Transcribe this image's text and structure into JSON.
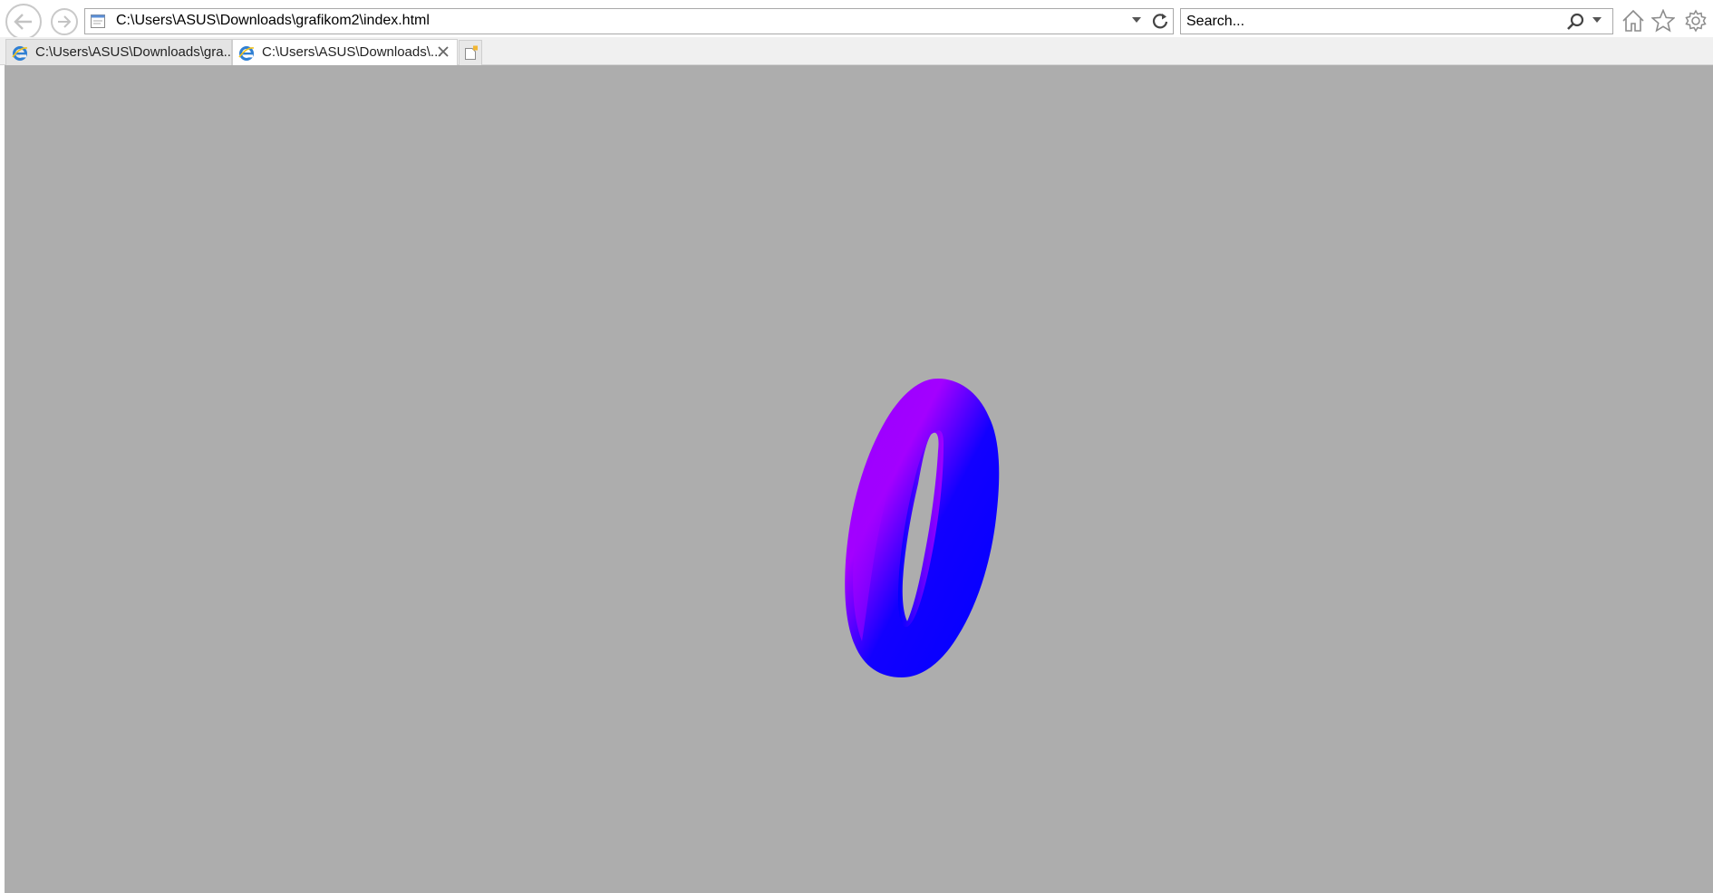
{
  "browser": {
    "address": "C:\\Users\\ASUS\\Downloads\\grafikom2\\index.html",
    "search_placeholder": "Search...",
    "tabs": [
      {
        "title": "C:\\Users\\ASUS\\Downloads\\gra...",
        "active": false
      },
      {
        "title": "C:\\Users\\ASUS\\Downloads\\...",
        "active": true
      }
    ],
    "icons": {
      "back": "back-arrow-icon",
      "forward": "forward-arrow-icon",
      "refresh": "refresh-icon",
      "search": "magnifier-icon",
      "home": "home-icon",
      "favorites": "star-icon",
      "settings": "gear-icon"
    }
  },
  "content": {
    "background_color": "#adadad",
    "object": "torus",
    "colors": [
      "#0000ff",
      "#8800ff",
      "#a000ff"
    ]
  }
}
